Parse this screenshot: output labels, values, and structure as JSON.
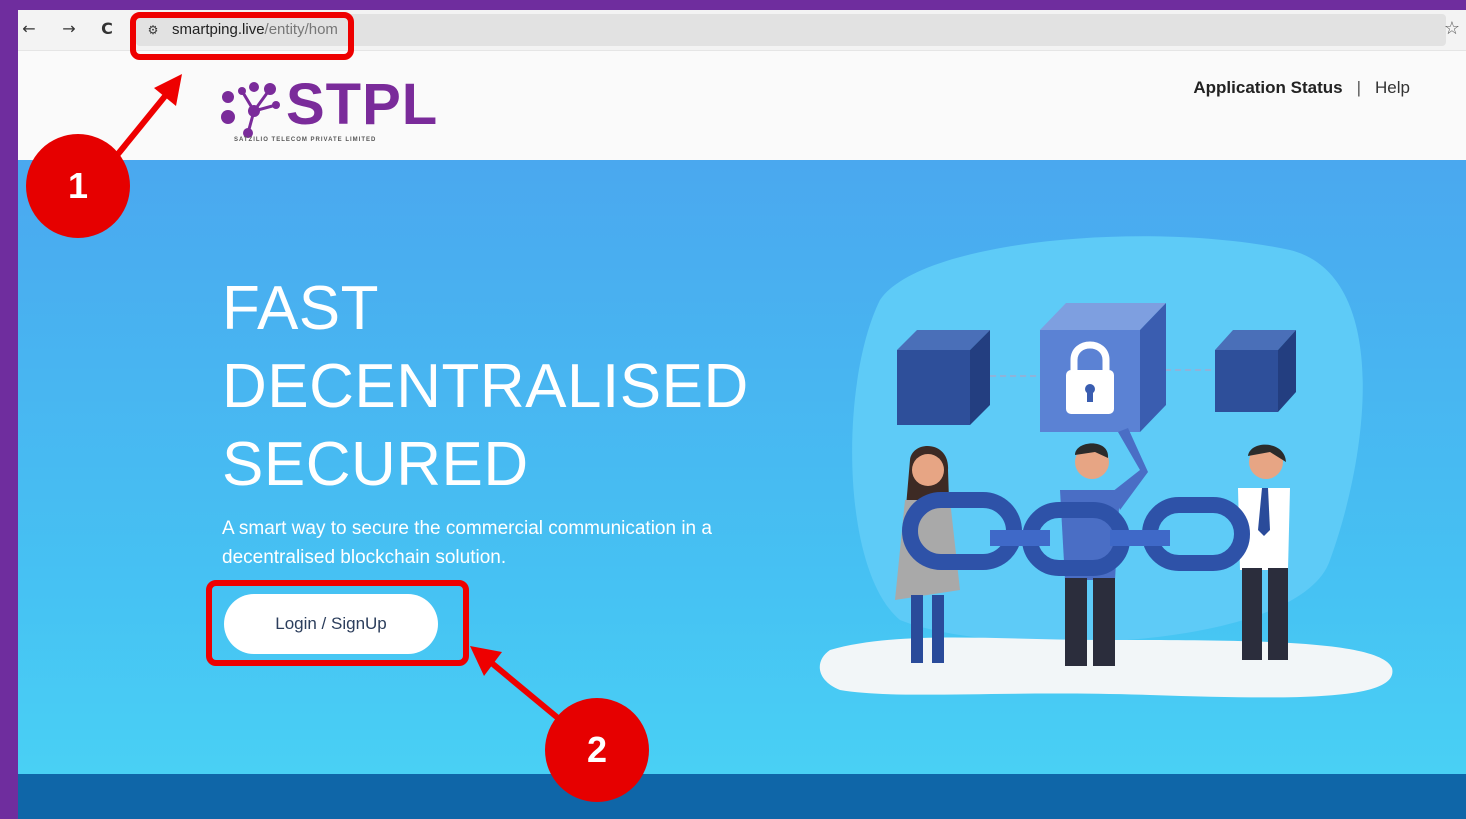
{
  "browser": {
    "back_icon": "←",
    "forward_icon": "→",
    "reload_icon": "C",
    "site_info_icon": "⚙",
    "url_domain": "smartping.live",
    "url_path": "/entity/hom",
    "bookmark_icon": "☆"
  },
  "header": {
    "logo_text": "STPL",
    "logo_subtitle": "SATZILIO TELECOM PRIVATE LIMITED",
    "links": {
      "application_status": "Application Status",
      "separator": "|",
      "help": "Help"
    }
  },
  "hero": {
    "headline": [
      "FAST",
      "DECENTRALISED",
      "SECURED"
    ],
    "subtitle": "A smart way to secure the commercial communication in a decentralised blockchain solution.",
    "login_button": "Login / SignUp"
  },
  "annotations": {
    "badge_1": "1",
    "badge_2": "2"
  },
  "colors": {
    "brand_purple": "#7a2b9a",
    "hero_blue": "#46c2f3",
    "footer_blue": "#0f66a8",
    "callout_red": "#e60000"
  }
}
